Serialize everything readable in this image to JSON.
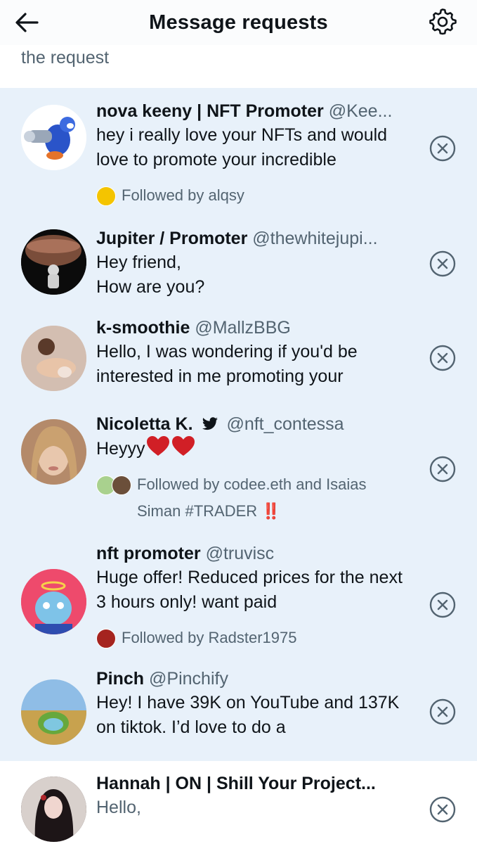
{
  "header": {
    "title": "Message requests",
    "back_icon": "arrow-left-icon",
    "settings_icon": "gear-icon"
  },
  "subtext": "the request",
  "requests": [
    {
      "name": "nova keeny | NFT Promoter",
      "handle": "@Kee...",
      "message": "hey i really love your NFTs and would love to promote your incredible",
      "followed_by": "Followed by alqsy",
      "unread": true
    },
    {
      "name": "Jupiter / Promoter",
      "handle": "@thewhitejupi...",
      "message_lines": [
        "Hey friend,",
        "How are you?"
      ],
      "unread": true
    },
    {
      "name": "k-smoothie",
      "handle": "@MallzBBG",
      "message": "Hello, I was wondering if you'd be interested in me promoting your",
      "unread": true
    },
    {
      "name": "Nicoletta K.",
      "handle": "@nft_contessa",
      "message": "Heyyy",
      "followed_by": "Followed by codee.eth and Isaias Siman #TRADER",
      "emoji_suffix": "‼️",
      "unread": true
    },
    {
      "name": "nft promoter",
      "handle": "@truvisc",
      "message": "Huge offer! Reduced prices for the next 3 hours only! want paid",
      "followed_by": "Followed by Radster1975",
      "unread": true
    },
    {
      "name": "Pinch",
      "handle": "@Pinchify",
      "message": "Hey! I have 39K on YouTube and 137K on tiktok. I’d love to do a",
      "unread": true
    },
    {
      "name": "Hannah | ON | Shill Your Project...",
      "handle": "",
      "message": "Hello,",
      "unread": false
    }
  ],
  "colors": {
    "unread_bg": "#e8f1fa",
    "text": "#0f1419",
    "secondary": "#536471",
    "verified": "#0f1419"
  },
  "icons": {
    "dismiss": "close-circle-icon",
    "verified": "twitter-bird-icon",
    "heart": "red-heart-icon"
  }
}
